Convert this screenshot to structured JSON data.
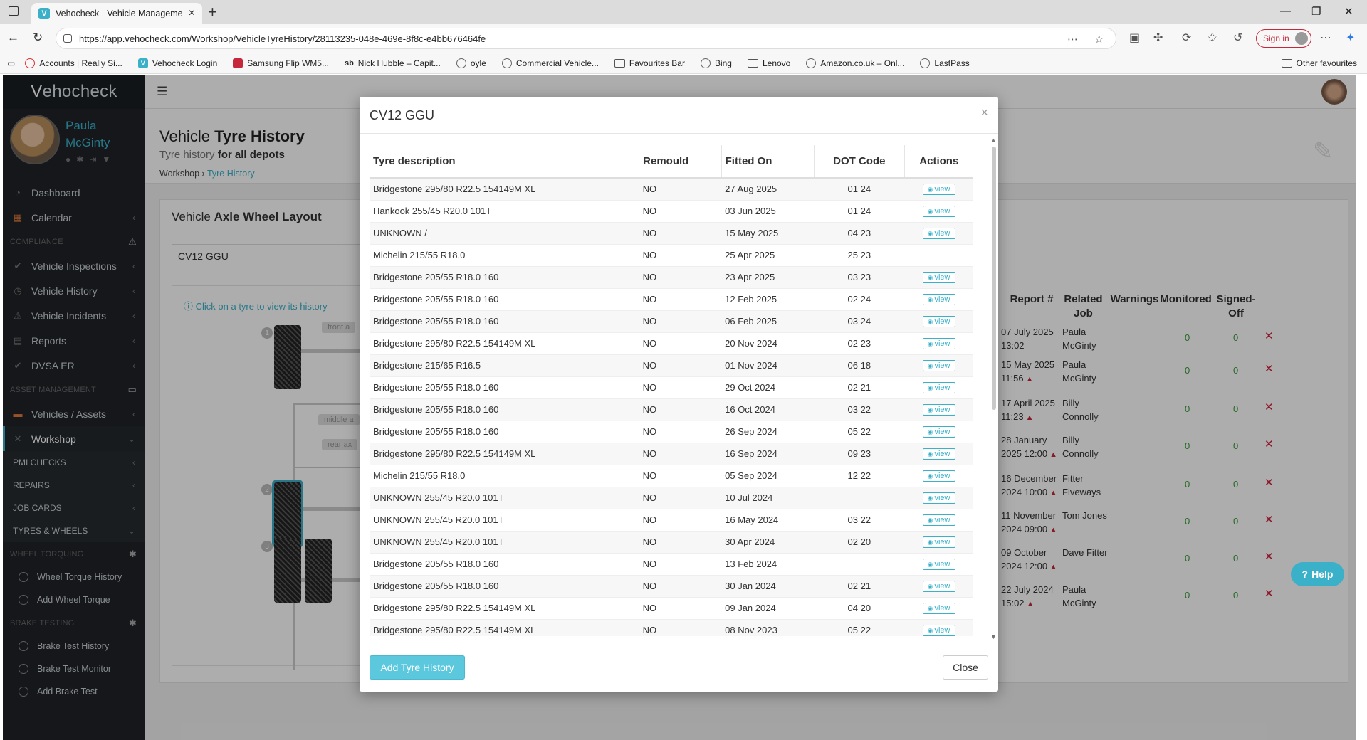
{
  "browser": {
    "tab_title": "Vehocheck - Vehicle Managemen",
    "url": "https://app.vehocheck.com/Workshop/VehicleTyreHistory/28113235-048e-469e-8f8c-e4bb676464fe",
    "sign_in": "Sign in",
    "bookmarks": [
      "Accounts | Really Si...",
      "Vehocheck Login",
      "Samsung Flip WM5...",
      "Nick Hubble – Capit...",
      "oyle",
      "Commercial Vehicle...",
      "Favourites Bar",
      "Bing",
      "Lenovo",
      "Amazon.co.uk – Onl...",
      "LastPass"
    ],
    "other_favourites": "Other favourites"
  },
  "sidebar": {
    "logo_v": "V",
    "logo_rest": "ehocheck",
    "user_name_1": "Paula",
    "user_name_2": "McGinty",
    "items": {
      "dashboard": "Dashboard",
      "calendar": "Calendar",
      "compliance": "COMPLIANCE",
      "vehicle_inspections": "Vehicle Inspections",
      "vehicle_history": "Vehicle History",
      "vehicle_incidents": "Vehicle Incidents",
      "reports": "Reports",
      "dvsa_er": "DVSA ER",
      "asset_management": "ASSET MANAGEMENT",
      "vehicles_assets": "Vehicles / Assets",
      "workshop": "Workshop",
      "pmi_checks": "PMI CHECKS",
      "repairs": "REPAIRS",
      "job_cards": "JOB CARDS",
      "tyres_wheels": "TYRES & WHEELS",
      "wheel_torquing": "WHEEL TORQUING",
      "wheel_torque_history": "Wheel Torque History",
      "add_wheel_torque": "Add Wheel Torque",
      "brake_testing": "BRAKE TESTING",
      "brake_test_history": "Brake Test History",
      "brake_test_monitor": "Brake Test Monitor",
      "add_brake_test": "Add Brake Test"
    }
  },
  "page": {
    "title_1": "Vehicle",
    "title_2": "Tyre History",
    "subtitle_1": "Tyre history",
    "subtitle_2": "for all depots",
    "breadcrumb_1": "Workshop",
    "breadcrumb_2": "Tyre History",
    "panel_title_1": "Vehicle",
    "panel_title_2": "Axle Wheel Layout",
    "reg_value": "CV12 GGU",
    "hint": "Click on a tyre to view its history",
    "axle_labels": [
      "front a",
      "middle a",
      "rear ax"
    ],
    "tyre_numbers": [
      "1",
      "2",
      "3"
    ]
  },
  "report_table": {
    "headers": [
      "Report #",
      "Related Job",
      "Warnings",
      "Monitored",
      "Signed-Off"
    ],
    "rows": [
      {
        "date": "07 July 2025 13:02",
        "user": "Paula McGinty",
        "warn": false,
        "monitored": "0",
        "signed": "0"
      },
      {
        "date": "15 May 2025 11:56",
        "user": "Paula McGinty",
        "warn": true,
        "monitored": "0",
        "signed": "0"
      },
      {
        "date": "17 April 2025 11:23",
        "user": "Billy Connolly",
        "warn": true,
        "monitored": "0",
        "signed": "0"
      },
      {
        "date": "28 January 2025 12:00",
        "user": "Billy Connolly",
        "warn": true,
        "monitored": "0",
        "signed": "0"
      },
      {
        "date": "16 December 2024 10:00",
        "user": "Fitter Fiveways",
        "warn": true,
        "monitored": "0",
        "signed": "0"
      },
      {
        "date": "11 November 2024 09:00",
        "user": "Tom Jones",
        "warn": true,
        "monitored": "0",
        "signed": "0"
      },
      {
        "date": "09 October 2024 12:00",
        "user": "Dave Fitter",
        "warn": true,
        "monitored": "0",
        "signed": "0"
      },
      {
        "date": "22 July 2024 15:02",
        "user": "Paula McGinty",
        "warn": true,
        "monitored": "0",
        "signed": "0"
      }
    ]
  },
  "help": "Help",
  "modal": {
    "title": "CV12 GGU",
    "headers": {
      "description": "Tyre description",
      "remould": "Remould",
      "fitted_on": "Fitted On",
      "dot_code": "DOT Code",
      "actions": "Actions"
    },
    "view_label": "view",
    "rows": [
      {
        "desc": "Bridgestone 295/80 R22.5 154149M XL",
        "remould": "NO",
        "fitted": "27 Aug 2025",
        "dot": "01 24",
        "view": true
      },
      {
        "desc": "Hankook 255/45 R20.0 101T",
        "remould": "NO",
        "fitted": "03 Jun 2025",
        "dot": "01 24",
        "view": true
      },
      {
        "desc": "UNKNOWN /",
        "remould": "NO",
        "fitted": "15 May 2025",
        "dot": "04 23",
        "view": true
      },
      {
        "desc": "Michelin 215/55 R18.0",
        "remould": "NO",
        "fitted": "25 Apr 2025",
        "dot": "25 23",
        "view": false
      },
      {
        "desc": "Bridgestone 205/55 R18.0 160",
        "remould": "NO",
        "fitted": "23 Apr 2025",
        "dot": "03 23",
        "view": true
      },
      {
        "desc": "Bridgestone 205/55 R18.0 160",
        "remould": "NO",
        "fitted": "12 Feb 2025",
        "dot": "02 24",
        "view": true
      },
      {
        "desc": "Bridgestone 205/55 R18.0 160",
        "remould": "NO",
        "fitted": "06 Feb 2025",
        "dot": "03 24",
        "view": true
      },
      {
        "desc": "Bridgestone 295/80 R22.5 154149M XL",
        "remould": "NO",
        "fitted": "20 Nov 2024",
        "dot": "02 23",
        "view": true
      },
      {
        "desc": "Bridgestone 215/65 R16.5",
        "remould": "NO",
        "fitted": "01 Nov 2024",
        "dot": "06 18",
        "view": true
      },
      {
        "desc": "Bridgestone 205/55 R18.0 160",
        "remould": "NO",
        "fitted": "29 Oct 2024",
        "dot": "02 21",
        "view": true
      },
      {
        "desc": "Bridgestone 205/55 R18.0 160",
        "remould": "NO",
        "fitted": "16 Oct 2024",
        "dot": "03 22",
        "view": true
      },
      {
        "desc": "Bridgestone 205/55 R18.0 160",
        "remould": "NO",
        "fitted": "26 Sep 2024",
        "dot": "05 22",
        "view": true
      },
      {
        "desc": "Bridgestone 295/80 R22.5 154149M XL",
        "remould": "NO",
        "fitted": "16 Sep 2024",
        "dot": "09 23",
        "view": true
      },
      {
        "desc": "Michelin 215/55 R18.0",
        "remould": "NO",
        "fitted": "05 Sep 2024",
        "dot": "12 22",
        "view": true
      },
      {
        "desc": "UNKNOWN 255/45 R20.0 101T",
        "remould": "NO",
        "fitted": "10 Jul 2024",
        "dot": "",
        "view": true
      },
      {
        "desc": "UNKNOWN 255/45 R20.0 101T",
        "remould": "NO",
        "fitted": "16 May 2024",
        "dot": "03 22",
        "view": true
      },
      {
        "desc": "UNKNOWN 255/45 R20.0 101T",
        "remould": "NO",
        "fitted": "30 Apr 2024",
        "dot": "02 20",
        "view": true
      },
      {
        "desc": "Bridgestone 205/55 R18.0 160",
        "remould": "NO",
        "fitted": "13 Feb 2024",
        "dot": "",
        "view": true
      },
      {
        "desc": "Bridgestone 205/55 R18.0 160",
        "remould": "NO",
        "fitted": "30 Jan 2024",
        "dot": "02 21",
        "view": true
      },
      {
        "desc": "Bridgestone 295/80 R22.5 154149M XL",
        "remould": "NO",
        "fitted": "09 Jan 2024",
        "dot": "04 20",
        "view": true
      },
      {
        "desc": "Bridgestone 295/80 R22.5 154149M XL",
        "remould": "NO",
        "fitted": "08 Nov 2023",
        "dot": "05 22",
        "view": true
      }
    ],
    "add_button": "Add Tyre History",
    "close_button": "Close"
  }
}
